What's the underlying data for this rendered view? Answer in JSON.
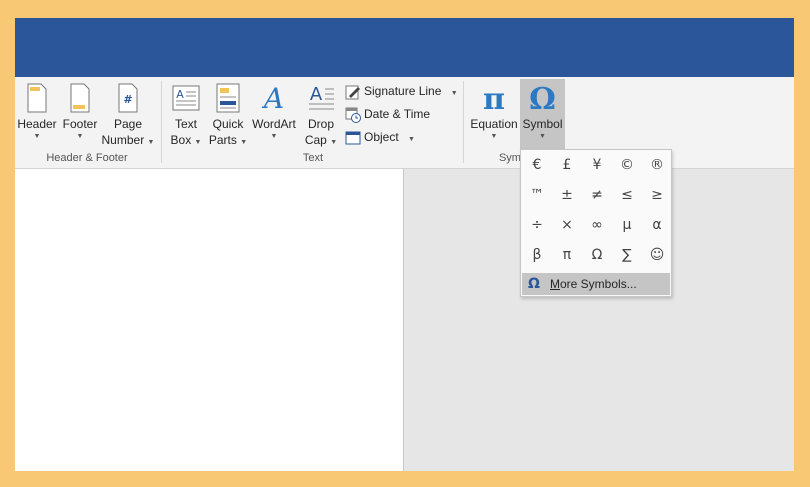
{
  "ribbon": {
    "groups": {
      "header_footer": "Header & Footer",
      "text": "Text",
      "symbols": "Symb"
    },
    "buttons": {
      "header": "Header",
      "footer": "Footer",
      "page_number_line1": "Page",
      "page_number_line2": "Number",
      "text_box_line1": "Text",
      "text_box_line2": "Box",
      "quick_parts_line1": "Quick",
      "quick_parts_line2": "Parts",
      "wordart": "WordArt",
      "drop_cap_line1": "Drop",
      "drop_cap_line2": "Cap",
      "signature_line": "Signature Line",
      "date_time": "Date & Time",
      "object": "Object",
      "equation": "Equation",
      "symbol": "Symbol",
      "equation_glyph": "π",
      "symbol_glyph": "Ω"
    }
  },
  "symbol_menu": {
    "symbols": [
      [
        "€",
        "£",
        "¥",
        "©",
        "®"
      ],
      [
        "™",
        "±",
        "≠",
        "≤",
        "≥"
      ],
      [
        "÷",
        "×",
        "∞",
        "µ",
        "α"
      ],
      [
        "β",
        "π",
        "Ω",
        "∑",
        "☺"
      ]
    ],
    "more_symbols_glyph": "Ω",
    "more_symbols_label": "More Symbols...",
    "more_symbols_accel": "M",
    "more_symbols_rest": "ore Symbols..."
  },
  "colors": {
    "title_bar": "#2b579a",
    "frame": "#f8c874",
    "highlight": "#c5c5c5"
  }
}
